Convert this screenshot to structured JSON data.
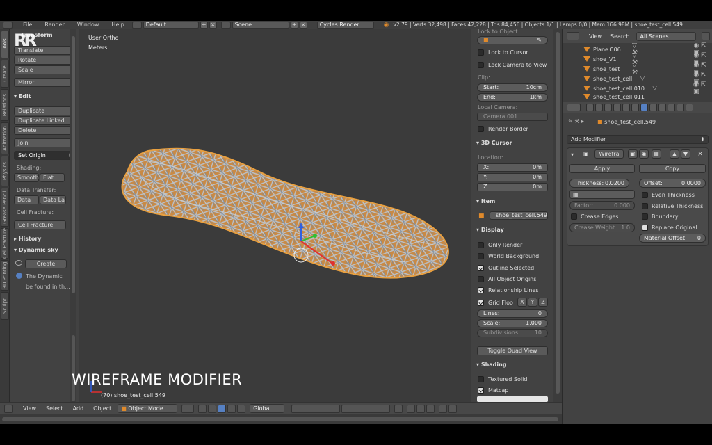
{
  "infobar": {
    "menus": [
      "File",
      "Render",
      "Window",
      "Help"
    ],
    "layout": "Default",
    "scene": "Scene",
    "engine": "Cycles Render",
    "stats": "v2.79 | Verts:32,498 | Faces:42,228 | Tris:84,456 | Objects:1/1 | Lamps:0/0 | Mem:166.98M | shoe_test_cell.549"
  },
  "logo": "RR",
  "toolbar": {
    "tabs": [
      "Tools",
      "Create",
      "Relations",
      "Animation",
      "Physics",
      "Grease Pencil",
      "Cell Fracture",
      "3D Printing",
      "Sculpt"
    ],
    "transform_header": "Transform",
    "transform_buttons": [
      "Translate",
      "Rotate",
      "Scale",
      "Mirror"
    ],
    "edit_header": "Edit",
    "edit_buttons": [
      "Duplicate",
      "Duplicate Linked",
      "Delete",
      "Join"
    ],
    "set_origin": "Set Origin",
    "shading_label": "Shading:",
    "smooth": "Smooth",
    "flat": "Flat",
    "data_transfer_label": "Data Transfer:",
    "data": "Data",
    "data_la": "Data La",
    "cell_fracture_label": "Cell Fracture:",
    "cell_fracture_btn": "Cell Fracture",
    "history_header": "History",
    "dynamic_sky_header": "Dynamic sky",
    "create_btn": "Create",
    "info_line1": "The Dynamic",
    "info_line2": "be found in th..."
  },
  "viewport": {
    "view_name": "User Ortho",
    "units": "Meters",
    "object_label": "(70) shoe_test_cell.549",
    "overlay_title": "WIREFRAME MODIFIER"
  },
  "viewport_header": {
    "menus": [
      "View",
      "Select",
      "Add",
      "Object"
    ],
    "mode": "Object Mode",
    "orientation": "Global"
  },
  "npanel": {
    "lock_to_object": "Lock to Object:",
    "lock_to_cursor": "Lock to Cursor",
    "lock_camera": "Lock Camera to View",
    "clip": "Clip:",
    "start_label": "Start:",
    "start_val": "10cm",
    "end_label": "End:",
    "end_val": "1km",
    "local_camera": "Local Camera:",
    "camera": "Camera.001",
    "render_border": "Render Border",
    "cursor_header": "3D Cursor",
    "location": "Location:",
    "x_label": "X:",
    "x_val": "0m",
    "y_label": "Y:",
    "y_val": "0m",
    "z_label": "Z:",
    "z_val": "0m",
    "item_header": "Item",
    "item_name": "shoe_test_cell.549",
    "display_header": "Display",
    "only_render": "Only Render",
    "world_background": "World Background",
    "outline_selected": "Outline Selected",
    "all_object_origins": "All Object Origins",
    "relationship_lines": "Relationship Lines",
    "grid_floor": "Grid Floo",
    "gx": "X",
    "gy": "Y",
    "gz": "Z",
    "lines_label": "Lines:",
    "lines_val": "0",
    "scale_label": "Scale:",
    "scale_val": "1.000",
    "subdiv_label": "Subdivisions:",
    "subdiv_val": "10",
    "toggle_quad": "Toggle Quad View",
    "shading_header": "Shading",
    "textured_solid": "Textured Solid",
    "matcap": "Matcap"
  },
  "outliner": {
    "view": "View",
    "search": "Search",
    "scenes": "All Scenes",
    "rows": [
      "Plane.006",
      "shoe_V1",
      "shoe_test",
      "shoe_test_cell",
      "shoe_test_cell.010",
      "shoe_test_cell.011"
    ]
  },
  "properties": {
    "object_name": "shoe_test_cell.549",
    "add_modifier": "Add Modifier",
    "modifier_name": "Wirefra",
    "apply": "Apply",
    "copy": "Copy",
    "thickness_label": "Thickness:",
    "thickness_val": "0.0200",
    "offset_label": "Offset:",
    "offset_val": "0.0000",
    "even_thickness": "Even Thickness",
    "factor_label": "Factor:",
    "factor_val": "0.000",
    "relative_thickness": "Relative Thickness",
    "crease_edges": "Crease Edges",
    "boundary": "Boundary",
    "crease_weight_label": "Crease Weight:",
    "crease_weight_val": "1.0",
    "replace_original": "Replace Original",
    "material_offset_label": "Material Offset:",
    "material_offset_val": "0"
  },
  "colors": {
    "accent": "#5680c2",
    "object_orange": "#e08a2b",
    "panel": "#424242",
    "viewport": "#3b3b3b"
  }
}
